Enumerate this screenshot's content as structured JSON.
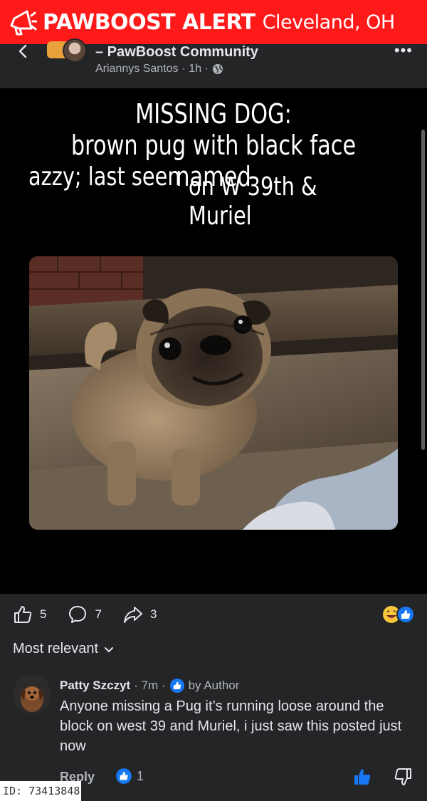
{
  "alert": {
    "title": "PAWBOOST ALERT",
    "location": "Cleveland, OH",
    "icon": "megaphone-icon",
    "bg_color": "#ff1a1a"
  },
  "post": {
    "group_name": "– PawBoost Community",
    "author": "Ariannys Santos",
    "time": "· 1h ·",
    "privacy_icon": "globe-icon",
    "more_label": "•••",
    "caption_line1": "MISSING DOG:",
    "caption_line2": "brown pug with black face named",
    "caption_line3a": "azzy; last seen",
    "caption_line3b": "on W 39th & Muriel"
  },
  "actions": {
    "likes": "5",
    "comments": "7",
    "shares": "3",
    "reaction_icons": [
      "laugh-emoji-icon",
      "like-reaction-icon"
    ]
  },
  "comments_sort": "Most relevant",
  "comment": {
    "author": "Patty Szczyt",
    "time": "· 7m ·",
    "badge": "by Author",
    "text": "Anyone missing a Pug it’s running loose around the block on west 39 and Muriel, i just saw this posted just now",
    "reply_label": "Reply",
    "like_count": "1"
  },
  "id_badge": "ID: 73413848",
  "colors": {
    "fb_blue": "#1877f2",
    "surface": "#242526",
    "text_secondary": "#b0b3b8"
  }
}
